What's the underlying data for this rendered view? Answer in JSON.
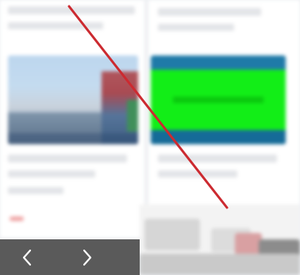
{
  "colors": {
    "page_background": "#eef0f3",
    "card_background": "#ffffff",
    "placeholder": "#e3e5e8",
    "thumbnail_right_green": "#12ee17",
    "thumbnail_right_blue": "#1f7aa8",
    "navbar_background": "#5a5a5a",
    "nav_arrow": "#ffffff",
    "strike_line": "#cc2a30"
  },
  "navigation": {
    "prev_icon": "chevron-left-icon",
    "next_icon": "chevron-right-icon"
  },
  "overlay": {
    "type": "diagonal-strike-line"
  }
}
